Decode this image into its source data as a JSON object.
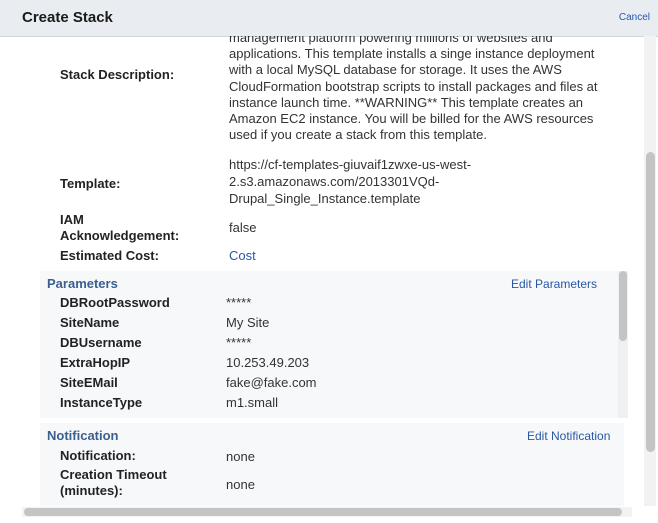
{
  "dialog": {
    "title": "Create Stack",
    "cancel_label": "Cancel"
  },
  "review": {
    "description_label": "Stack Description:",
    "description_value": "management platform powering millions of websites and applications. This template installs a singe instance deployment with a local MySQL database for storage. It uses the AWS CloudFormation bootstrap scripts to install packages and files at instance launch time. **WARNING** This template creates an Amazon EC2 instance. You will be billed for the AWS resources used if you create a stack from this template.",
    "template_label": "Template:",
    "template_line1": "https://cf-templates-giuvaif1zwxe-us-west-",
    "template_line2": "2.s3.amazonaws.com/2013301VQd-",
    "template_line3": "Drupal_Single_Instance.template",
    "iam_label_line1": "IAM",
    "iam_label_line2": "Acknowledgement:",
    "iam_value": "false",
    "cost_label": "Estimated Cost:",
    "cost_link": "Cost"
  },
  "parameters": {
    "title": "Parameters",
    "edit_label": "Edit Parameters",
    "rows": [
      {
        "name": "DBRootPassword",
        "value": "*****"
      },
      {
        "name": "SiteName",
        "value": "My Site"
      },
      {
        "name": "DBUsername",
        "value": "*****"
      },
      {
        "name": "ExtraHopIP",
        "value": "10.253.49.203"
      },
      {
        "name": "SiteEMail",
        "value": "fake@fake.com"
      },
      {
        "name": "InstanceType",
        "value": "m1.small"
      }
    ]
  },
  "notification": {
    "title": "Notification",
    "edit_label": "Edit Notification",
    "notification_label": "Notification:",
    "notification_value": "none",
    "timeout_label_line1": "Creation Timeout",
    "timeout_label_line2": "(minutes):",
    "timeout_value": "none"
  }
}
